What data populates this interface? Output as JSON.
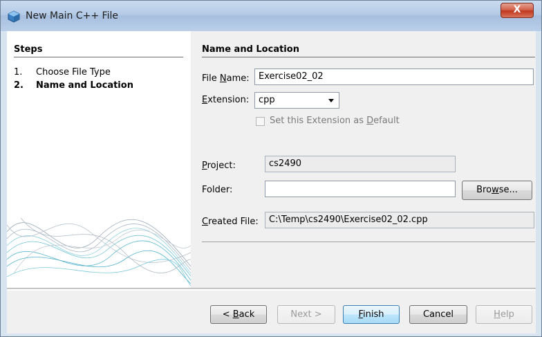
{
  "window": {
    "title": "New Main C++ File",
    "close_label": "X"
  },
  "steps": {
    "heading": "Steps",
    "items": [
      {
        "num": "1.",
        "label": "Choose File Type"
      },
      {
        "num": "2.",
        "label": "Name and Location"
      }
    ]
  },
  "main": {
    "heading": "Name and Location",
    "file_name": {
      "label_pre": "File ",
      "label_u": "N",
      "label_post": "ame:",
      "value": "Exercise02_02"
    },
    "extension": {
      "label_u": "E",
      "label_post": "xtension:",
      "value": "cpp"
    },
    "default_ext": {
      "label_pre": "Set this Extension as ",
      "label_u": "D",
      "label_post": "efault",
      "checked": false
    },
    "project": {
      "label_u": "P",
      "label_post": "roject:",
      "value": "cs2490"
    },
    "folder": {
      "label": "Folder:",
      "value": ""
    },
    "browse": {
      "pre": "Bro",
      "u": "w",
      "post": "se..."
    },
    "created_file": {
      "label_u": "C",
      "label_post": "reated File:",
      "value": "C:\\Temp\\cs2490\\Exercise02_02.cpp"
    }
  },
  "buttons": {
    "back": {
      "pre": "< ",
      "u": "B",
      "post": "ack"
    },
    "next": "Next >",
    "finish": {
      "u": "F",
      "post": "inish"
    },
    "cancel": "Cancel",
    "help": {
      "u": "H",
      "post": "elp"
    }
  },
  "colors": {
    "accent": "#3c7fb1",
    "title_bar": "#b5cbe6",
    "close": "#c0391f"
  },
  "icons": {
    "app": "netbeans-cube-icon",
    "dropdown": "chevron-down-icon"
  }
}
